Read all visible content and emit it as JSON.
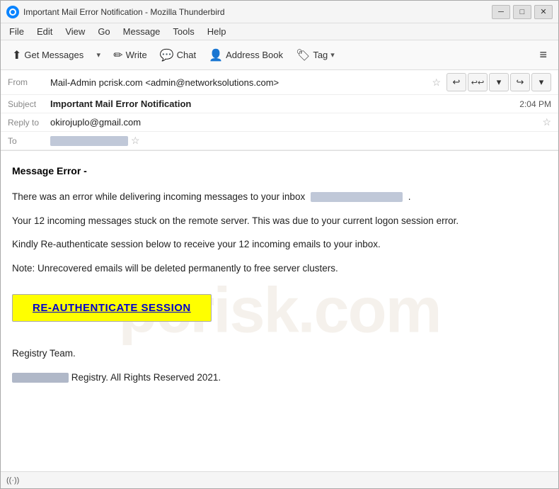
{
  "window": {
    "title": "Important Mail Error Notification - Mozilla Thunderbird",
    "controls": {
      "minimize": "─",
      "maximize": "□",
      "close": "✕"
    }
  },
  "menubar": {
    "items": [
      "File",
      "Edit",
      "View",
      "Go",
      "Message",
      "Tools",
      "Help"
    ]
  },
  "toolbar": {
    "get_messages_label": "Get Messages",
    "write_label": "Write",
    "chat_label": "Chat",
    "address_book_label": "Address Book",
    "tag_label": "Tag",
    "dropdown_char": "▾",
    "hamburger": "≡"
  },
  "email": {
    "from_label": "From",
    "from_value": "Mail-Admin pcrisk.com <admin@networksolutions.com>",
    "subject_label": "Subject",
    "subject_value": "Important Mail Error Notification",
    "time": "2:04 PM",
    "reply_to_label": "Reply to",
    "reply_to_value": "okirojuplo@gmail.com",
    "to_label": "To",
    "nav_back": "↩",
    "nav_reply_all": "↩↩",
    "nav_down": "▾",
    "nav_forward": "↪",
    "nav_more": "▾"
  },
  "body": {
    "heading": "Message Error -",
    "paragraph1": "There was an error while delivering incoming messages to your inbox",
    "paragraph1_suffix": ".",
    "paragraph2": "Your 12 incoming messages stuck on the remote server. This was due to your current logon session error.",
    "paragraph3": "Kindly Re-authenticate session below to receive your 12 incoming emails to your inbox.",
    "paragraph4": "Note: Unrecovered emails will be deleted permanently to free server clusters.",
    "reauth_button": "RE-AUTHENTICATE SESSION",
    "sign_off": "Registry Team.",
    "footer": "Registry. All Rights Reserved 2021."
  },
  "statusbar": {
    "signal_icon": "((·))"
  },
  "colors": {
    "accent_blue": "#1565c0",
    "reauth_bg": "#ffff00",
    "reauth_text": "#0000cc",
    "window_border": "#aaa"
  }
}
